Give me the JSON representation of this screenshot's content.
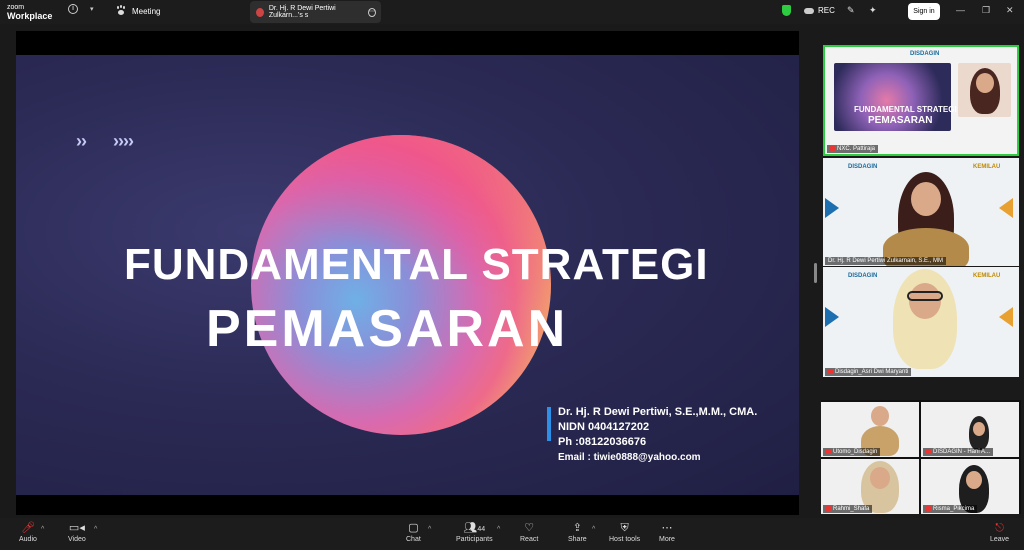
{
  "app": {
    "logo_line1": "zoom",
    "logo_line2": "Workplace",
    "info_icon": "info-icon",
    "meeting_label": "Meeting",
    "tab_title": "Dr. Hj. R Dewi Pertiwi Zulkarn...'s s",
    "rec_label": "REC",
    "sign_in_label": "Sign in",
    "accent_color": "#2ecc40"
  },
  "slide": {
    "title_line1": "FUNDAMENTAL STRATEGI",
    "title_line2": "PEMASARAN",
    "presenter": "Dr. Hj. R Dewi Pertiwi, S.E.,M.M., CMA.",
    "nidn": "NIDN 0404127202",
    "phone": "Ph :08122036676",
    "email": "Email : tiwie0888@yahoo.com"
  },
  "thumbnails": [
    {
      "logo": "DISDAGIN",
      "slide_line1": "FUNDAMENTAL STRATEGI",
      "slide_line2": "PEMASARAN",
      "name": "NXC. Pattiraja"
    },
    {
      "logo": "DISDAGIN",
      "logo_right": "KEMILAU",
      "name": "Dr. Hj. R Dewi  Pertiwi Zulkarnain, S.E., MM"
    },
    {
      "logo": "DISDAGIN",
      "logo_right": "KEMILAU",
      "name": "Disdagin_Asri Dwi Maryanti"
    }
  ],
  "gallery": [
    {
      "name": "Utomo_Disdagin"
    },
    {
      "name": "DISDAGIN - Hani A..."
    },
    {
      "name": "Rahmi_Shafa"
    },
    {
      "name": "Risma_Pikcima"
    }
  ],
  "toolbar": {
    "audio": "Audio",
    "video": "Video",
    "chat": "Chat",
    "participants": "Participants",
    "participants_count": "44",
    "react": "React",
    "share": "Share",
    "host_tools": "Host tools",
    "more": "More",
    "leave": "Leave"
  }
}
